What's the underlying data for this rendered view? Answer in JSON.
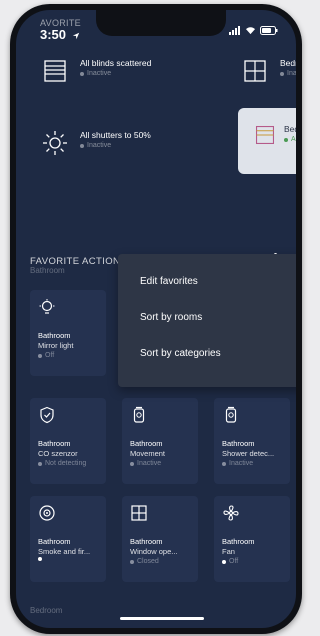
{
  "status_bar": {
    "section_label": "AVORITE",
    "time": "3:50"
  },
  "scenes": [
    {
      "title": "All blinds scattered",
      "status": "Inactive",
      "icon": "blinds-icon"
    },
    {
      "title": "Bedro",
      "status": "Ina",
      "icon": "window-icon"
    },
    {
      "title": "All shutters to 50%",
      "status": "Inactive",
      "icon": "sun-icon"
    },
    {
      "title": "Bedro",
      "status": "Ac",
      "icon": "blinds-icon"
    }
  ],
  "favorite_actions": {
    "title": "FAVORITE ACTIONS"
  },
  "rooms": {
    "bathroom": "Bathroom",
    "bedroom": "Bedroom"
  },
  "menu": {
    "items": [
      "Edit favorites",
      "Sort by rooms",
      "Sort by categories"
    ]
  },
  "tiles": [
    {
      "room": "Bathroom",
      "name": "Mirror light",
      "state": "Off",
      "icon": "lightbulb-icon"
    },
    {
      "room": "Bathroom",
      "name": "CO szenzor",
      "state": "Not detecting",
      "icon": "shield-icon"
    },
    {
      "room": "Bathroom",
      "name": "Movement",
      "state": "Inactive",
      "icon": "motion-sensor-icon"
    },
    {
      "room": "Bathroom",
      "name": "Shower detec...",
      "state": "Inactive",
      "icon": "motion-sensor-icon"
    },
    {
      "room": "Bathroom",
      "name": "Smoke and fir...",
      "state": "",
      "icon": "smoke-detector-icon"
    },
    {
      "room": "Bathroom",
      "name": "Window ope...",
      "state": "Closed",
      "icon": "window-icon"
    },
    {
      "room": "Bathroom",
      "name": "Fan",
      "state": "Off",
      "icon": "fan-icon"
    }
  ],
  "colors": {
    "background": "#1e2a44",
    "tile": "#253250",
    "menu": "#2e3646",
    "active": "#4a9a54"
  }
}
